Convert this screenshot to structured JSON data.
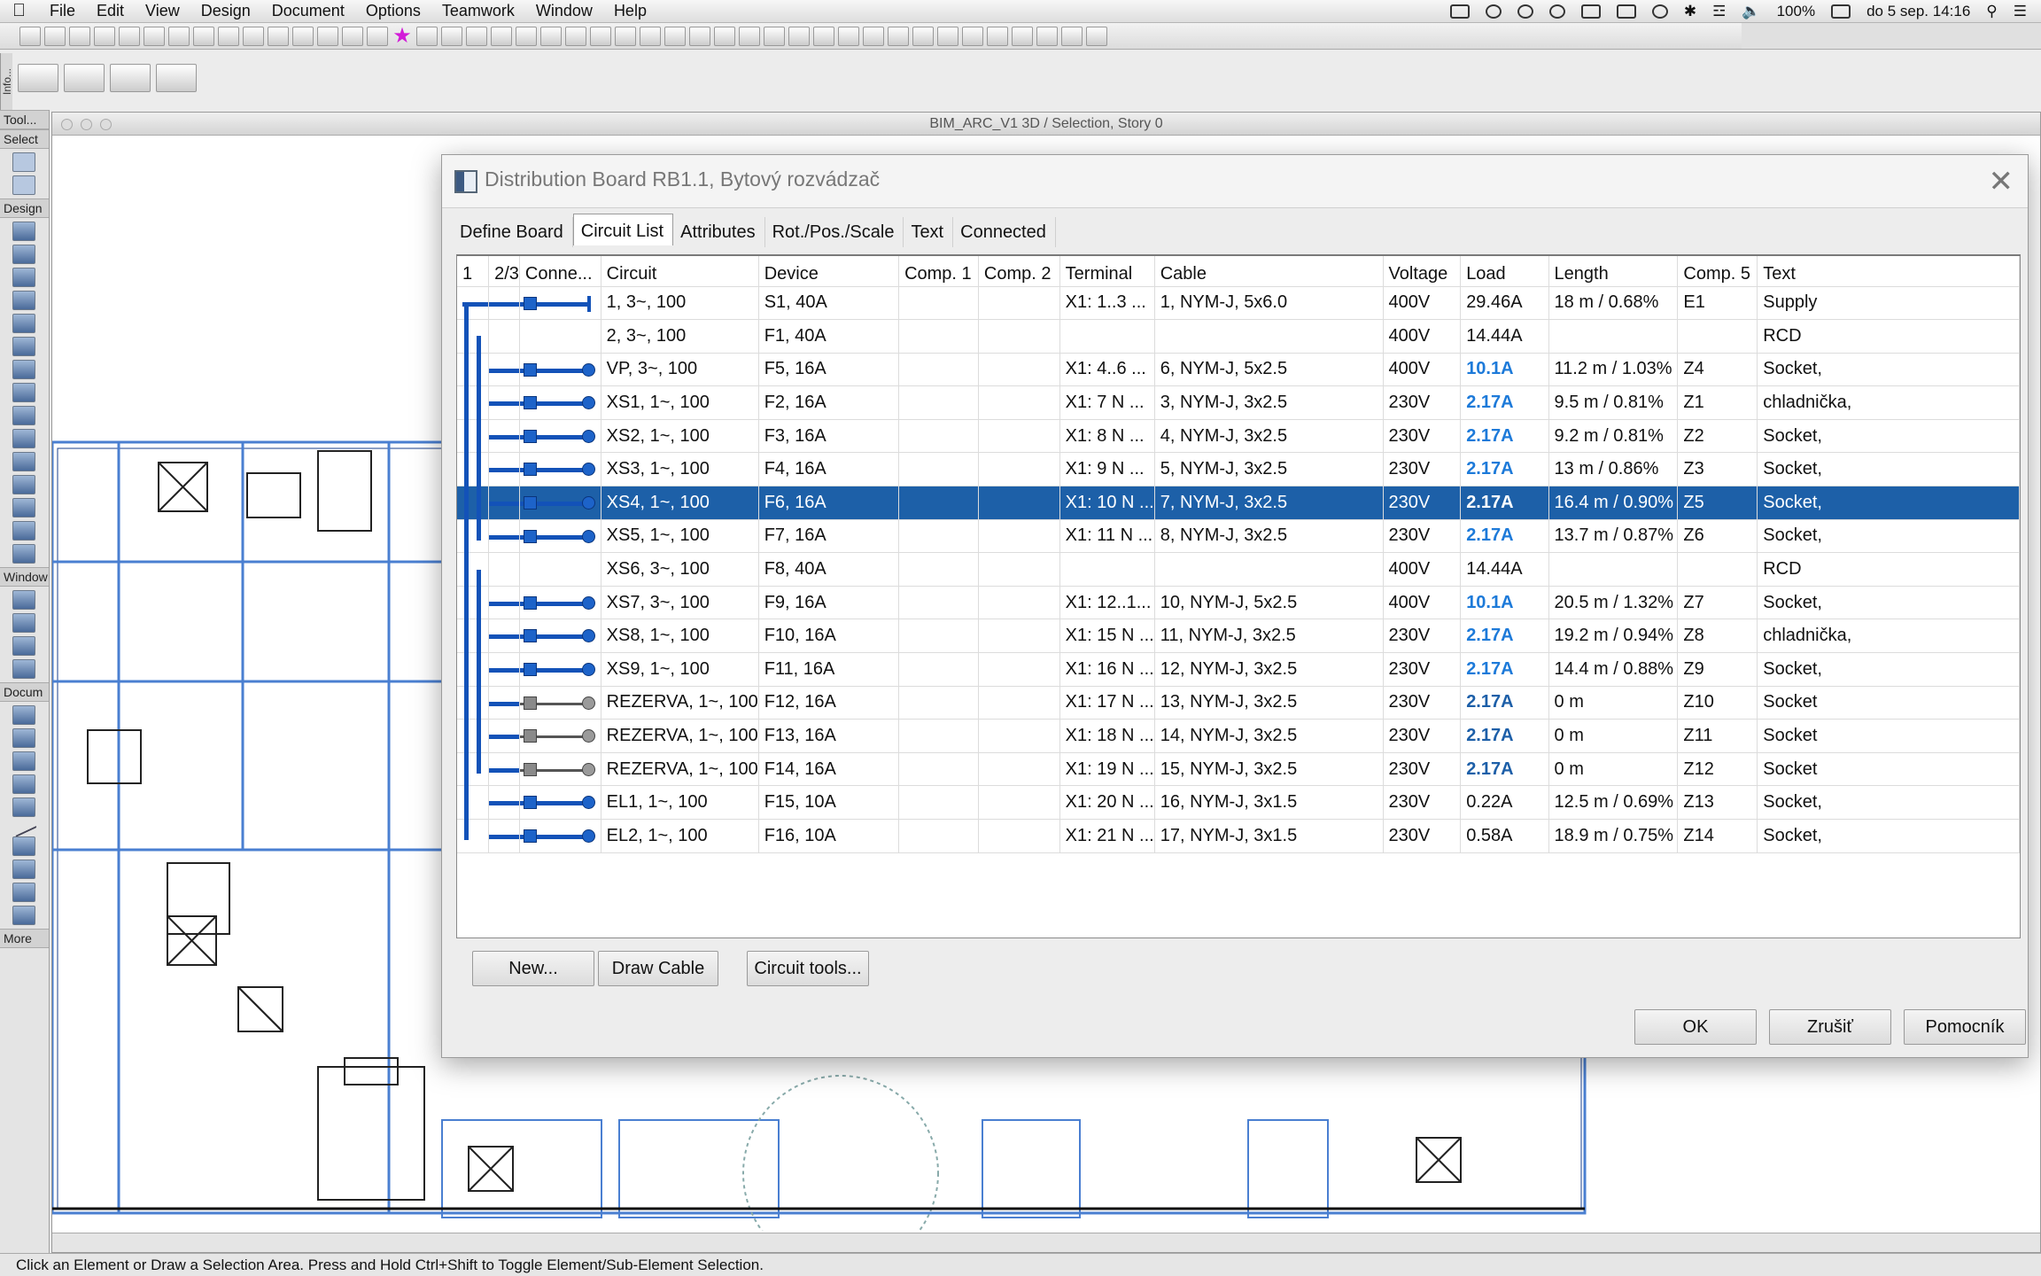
{
  "menubar": {
    "items": [
      "File",
      "Edit",
      "View",
      "Design",
      "Document",
      "Options",
      "Teamwork",
      "Window",
      "Help"
    ],
    "battery": "100%",
    "clock": "do 5 sep.  14:16"
  },
  "toolbox": {
    "sections": [
      "Select",
      "Design",
      "Window",
      "Docum",
      "More"
    ]
  },
  "info_tab": "Info...",
  "tool_tab": "Tool...",
  "draw_window": {
    "title": "BIM_ARC_V1 3D / Selection, Story 0"
  },
  "status_bar": {
    "text": "Click an Element or Draw a Selection Area. Press and Hold Ctrl+Shift to Toggle Element/Sub-Element Selection."
  },
  "dialog": {
    "title": "Distribution Board RB1.1, Bytový rozvádzač",
    "tabs": [
      "Define Board",
      "Circuit List",
      "Attributes",
      "Rot./Pos./Scale",
      "Text",
      "Connected"
    ],
    "active_tab": "Circuit List",
    "columns": [
      "1",
      "2/3",
      "Conne...",
      "Circuit",
      "Device",
      "Comp. 1",
      "Comp. 2",
      "Terminal",
      "Cable",
      "Voltage",
      "Load",
      "Length",
      "Comp. 5",
      "Text"
    ],
    "rows": [
      {
        "circuit": "1, 3~, 100",
        "device": "S1, 40A",
        "terminal": "X1: 1..3 ...",
        "cable": "1, NYM-J, 5x6.0",
        "voltage": "400V",
        "load": "29.46A",
        "length": "18 m / 0.68%",
        "comp5": "E1",
        "text": "Supply"
      },
      {
        "circuit": "2, 3~, 100",
        "device": "F1, 40A",
        "terminal": "",
        "cable": "",
        "voltage": "400V",
        "load": "14.44A",
        "length": "",
        "comp5": "",
        "text": "RCD"
      },
      {
        "circuit": "VP, 3~, 100",
        "device": "F5, 16A",
        "terminal": "X1: 4..6 ...",
        "cable": "6, NYM-J, 5x2.5",
        "voltage": "400V",
        "load": "10.1A",
        "length": "11.2 m / 1.03%",
        "comp5": "Z4",
        "text": "Socket,"
      },
      {
        "circuit": "XS1, 1~, 100",
        "device": "F2, 16A",
        "terminal": "X1: 7 N ...",
        "cable": "3, NYM-J, 3x2.5",
        "voltage": "230V",
        "load": "2.17A",
        "length": "9.5 m / 0.81%",
        "comp5": "Z1",
        "text": "chladnička,"
      },
      {
        "circuit": "XS2, 1~, 100",
        "device": "F3, 16A",
        "terminal": "X1: 8 N ...",
        "cable": "4, NYM-J, 3x2.5",
        "voltage": "230V",
        "load": "2.17A",
        "length": "9.2 m / 0.81%",
        "comp5": "Z2",
        "text": "Socket,"
      },
      {
        "circuit": "XS3, 1~, 100",
        "device": "F4, 16A",
        "terminal": "X1: 9 N ...",
        "cable": "5, NYM-J, 3x2.5",
        "voltage": "230V",
        "load": "2.17A",
        "length": "13 m / 0.86%",
        "comp5": "Z3",
        "text": "Socket,"
      },
      {
        "circuit": "XS4, 1~, 100",
        "device": "F6, 16A",
        "terminal": "X1: 10 N ...",
        "cable": "7, NYM-J, 3x2.5",
        "voltage": "230V",
        "load": "2.17A",
        "length": "16.4 m / 0.90%",
        "comp5": "Z5",
        "text": "Socket,"
      },
      {
        "circuit": "XS5, 1~, 100",
        "device": "F7, 16A",
        "terminal": "X1: 11 N ...",
        "cable": "8, NYM-J, 3x2.5",
        "voltage": "230V",
        "load": "2.17A",
        "length": "13.7 m / 0.87%",
        "comp5": "Z6",
        "text": "Socket,"
      },
      {
        "circuit": "XS6, 3~, 100",
        "device": "F8, 40A",
        "terminal": "",
        "cable": "",
        "voltage": "400V",
        "load": "14.44A",
        "length": "",
        "comp5": "",
        "text": "RCD"
      },
      {
        "circuit": "XS7, 3~, 100",
        "device": "F9, 16A",
        "terminal": "X1: 12..1...",
        "cable": "10, NYM-J, 5x2.5",
        "voltage": "400V",
        "load": "10.1A",
        "length": "20.5 m / 1.32%",
        "comp5": "Z7",
        "text": "Socket,"
      },
      {
        "circuit": "XS8, 1~, 100",
        "device": "F10, 16A",
        "terminal": "X1: 15 N ...",
        "cable": "11, NYM-J, 3x2.5",
        "voltage": "230V",
        "load": "2.17A",
        "length": "19.2 m / 0.94%",
        "comp5": "Z8",
        "text": "chladnička,"
      },
      {
        "circuit": "XS9, 1~, 100",
        "device": "F11, 16A",
        "terminal": "X1: 16 N ...",
        "cable": "12, NYM-J, 3x2.5",
        "voltage": "230V",
        "load": "2.17A",
        "length": "14.4 m / 0.88%",
        "comp5": "Z9",
        "text": "Socket,"
      },
      {
        "circuit": "REZERVA, 1~, 100",
        "device": "F12, 16A",
        "terminal": "X1: 17 N ...",
        "cable": "13, NYM-J, 3x2.5",
        "voltage": "230V",
        "load": "2.17A",
        "length": "0 m",
        "comp5": "Z10",
        "text": "Socket"
      },
      {
        "circuit": "REZERVA, 1~, 100",
        "device": "F13, 16A",
        "terminal": "X1: 18 N ...",
        "cable": "14, NYM-J, 3x2.5",
        "voltage": "230V",
        "load": "2.17A",
        "length": "0 m",
        "comp5": "Z11",
        "text": "Socket"
      },
      {
        "circuit": "REZERVA, 1~, 100",
        "device": "F14, 16A",
        "terminal": "X1: 19 N ...",
        "cable": "15, NYM-J, 3x2.5",
        "voltage": "230V",
        "load": "2.17A",
        "length": "0 m",
        "comp5": "Z12",
        "text": "Socket"
      },
      {
        "circuit": "EL1, 1~, 100",
        "device": "F15, 10A",
        "terminal": "X1: 20 N ...",
        "cable": "16, NYM-J, 3x1.5",
        "voltage": "230V",
        "load": "0.22A",
        "length": "12.5 m / 0.69%",
        "comp5": "Z13",
        "text": "Socket,"
      },
      {
        "circuit": "EL2, 1~, 100",
        "device": "F16, 10A",
        "terminal": "X1: 21 N ...",
        "cable": "17, NYM-J, 3x1.5",
        "voltage": "230V",
        "load": "0.58A",
        "length": "18.9 m / 0.75%",
        "comp5": "Z14",
        "text": "Socket,"
      }
    ],
    "selected_row": 6,
    "buttons": {
      "new": "New...",
      "draw_cable": "Draw Cable",
      "circuit_tools": "Circuit tools...",
      "ok": "OK",
      "cancel": "Zrušiť",
      "help": "Pomocník"
    }
  },
  "colors": {
    "selection": "#1d60a8",
    "connector": "#1352b8",
    "load_highlight": "#1d7ad9"
  }
}
